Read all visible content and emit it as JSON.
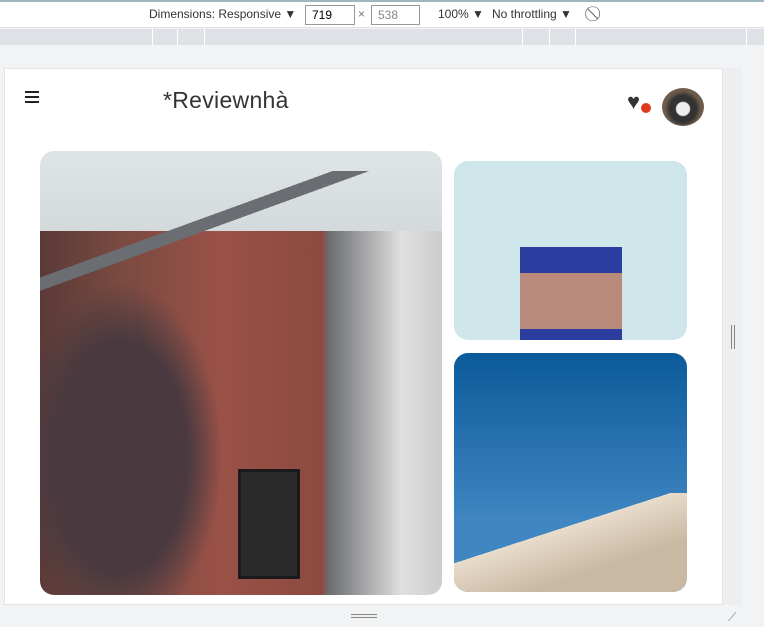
{
  "devtools": {
    "dimensions_label": "Dimensions: Responsive ▼",
    "width": "719",
    "times": "×",
    "height": "538",
    "zoom": "100% ▼",
    "throttling": "No throttling ▼",
    "rotate_icon": "rotate-icon"
  },
  "site": {
    "logo": "*Reviewnhà",
    "menu_icon": "hamburger-icon",
    "favorites_icon": "heart-icon",
    "notification_color": "#e03a1e",
    "avatar": "husky-dog-avatar"
  },
  "gallery": {
    "images": [
      "red wooden house",
      "blue-topped building against sky",
      "apartment block under blue sky"
    ]
  }
}
